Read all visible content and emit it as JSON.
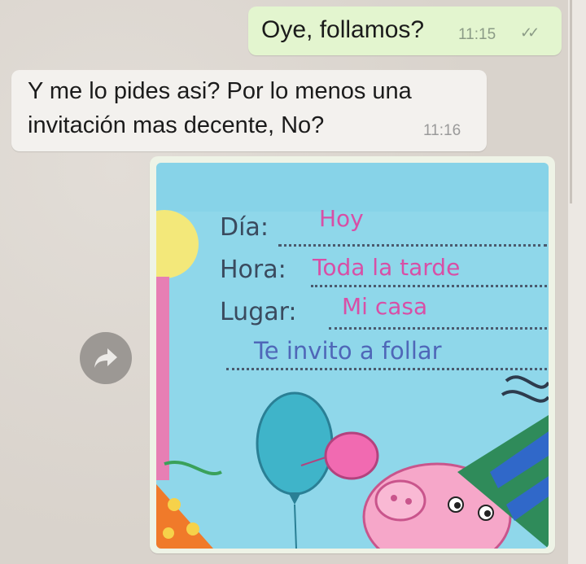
{
  "chat": {
    "outgoing": {
      "text": "Oye, follamos?",
      "time": "11:15",
      "status_icon": "double-check-icon"
    },
    "incoming": {
      "line1": "Y me lo pides asi? Por lo menos una",
      "line2": "invitación mas decente, No?",
      "time": "11:16"
    },
    "forward_icon": "forward-arrow-icon"
  },
  "invitation": {
    "dia_label": "Día:",
    "dia_value": "Hoy",
    "hora_label": "Hora:",
    "hora_value": "Toda la tarde",
    "lugar_label": "Lugar:",
    "lugar_value": "Mi casa",
    "invite_line": "Te invito a follar"
  },
  "colors": {
    "outgoing_bubble": "#e3f5cf",
    "incoming_bubble": "#f3f1ee",
    "invitation_bg": "#8fd7ea",
    "handwriting_pink": "#d84fa6",
    "handwriting_label": "#3a4a5e"
  }
}
